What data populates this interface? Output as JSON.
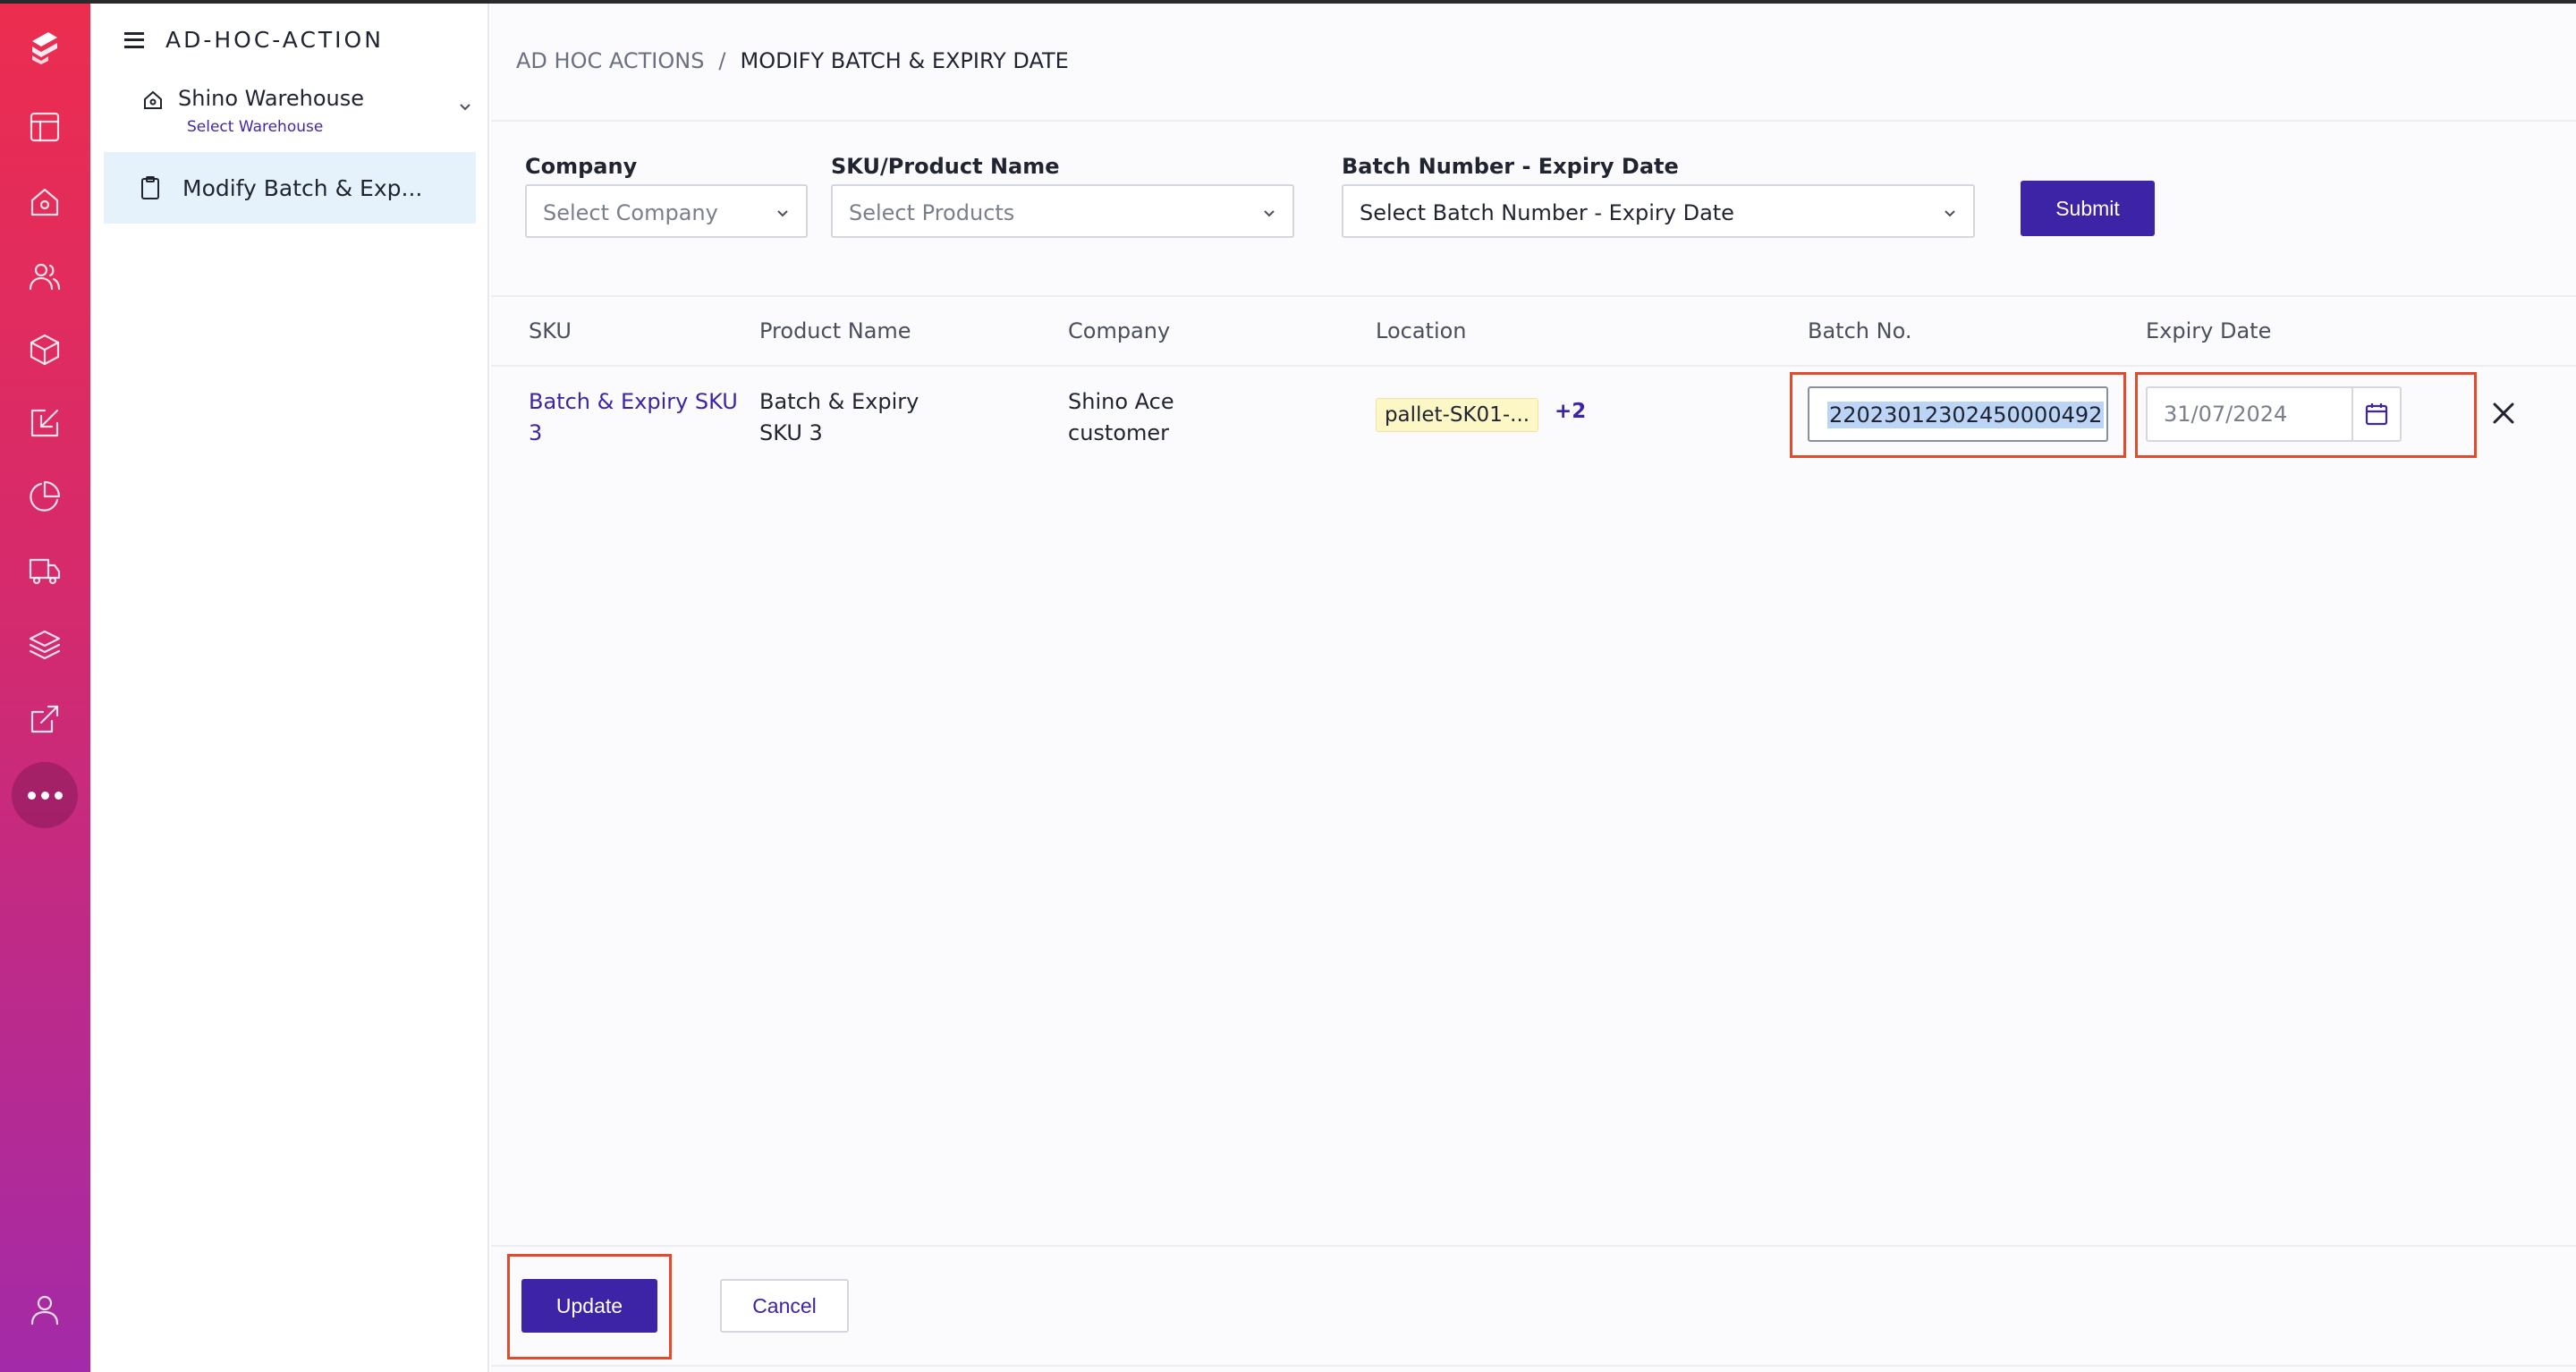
{
  "sidebar": {
    "title": "AD-HOC-ACTION",
    "warehouse": {
      "name": "Shino Warehouse",
      "sub": "Select Warehouse"
    },
    "items": [
      {
        "label": "Modify Batch & Exp..."
      }
    ]
  },
  "rail": {
    "icons": [
      "logo-icon",
      "layout-icon",
      "home-icon",
      "users-icon",
      "package-icon",
      "inbound-icon",
      "pie-chart-icon",
      "truck-icon",
      "layers-icon",
      "external-link-icon",
      "more-icon",
      "user-icon"
    ]
  },
  "breadcrumb": {
    "parent": "AD HOC ACTIONS",
    "separator": "/",
    "current": "MODIFY BATCH & EXPIRY DATE"
  },
  "filters": {
    "company": {
      "label": "Company",
      "placeholder": "Select Company"
    },
    "product": {
      "label": "SKU/Product Name",
      "placeholder": "Select Products"
    },
    "batch": {
      "label": "Batch Number - Expiry Date",
      "placeholder": "Select Batch Number - Expiry Date"
    },
    "submit_label": "Submit"
  },
  "table": {
    "columns": [
      "SKU",
      "Product Name",
      "Company",
      "Location",
      "Batch No.",
      "Expiry Date"
    ],
    "rows": [
      {
        "sku_line1": "Batch & Expiry SKU",
        "sku_line2": "3",
        "product_line1": "Batch & Expiry",
        "product_line2": "SKU 3",
        "company_line1": "Shino Ace",
        "company_line2": "customer",
        "location": "pallet-SK01-...",
        "location_more": "+2",
        "batch_no": "22023012302450000492",
        "expiry_date": "31/07/2024"
      }
    ]
  },
  "footer": {
    "update_label": "Update",
    "cancel_label": "Cancel"
  },
  "colors": {
    "accent": "#3d23a6",
    "highlight": "#e34a2b",
    "rail_top": "#ec2d4f",
    "rail_bottom": "#a32aa8"
  }
}
